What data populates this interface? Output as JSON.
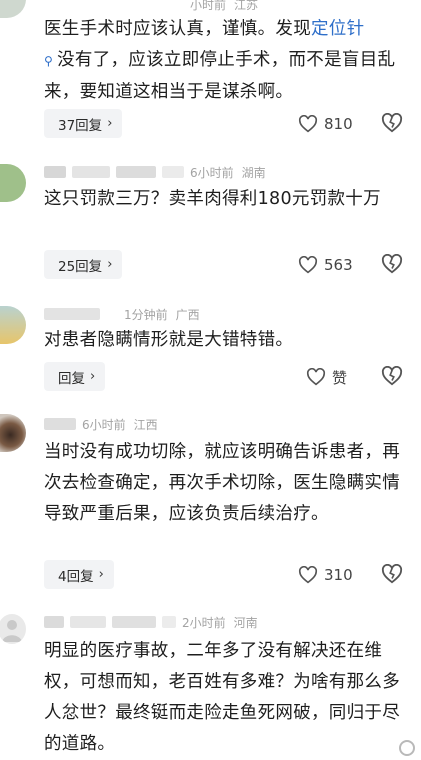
{
  "comments": [
    {
      "meta_time": "小时前",
      "meta_location": "江苏",
      "text_before_link": "医生手术时应该认真，谨慎。发现",
      "link_text": "定位针",
      "text_after_link": "没有了，应该立即停止手术，而不是盲目乱来，要知道这相当于是谋杀啊。",
      "reply_label": "37回复",
      "like_count": "810"
    },
    {
      "meta_time": "6小时前",
      "meta_location": "湖南",
      "text": "这只罚款三万？卖羊肉得利180元罚款十万",
      "reply_label": "25回复",
      "like_count": "563"
    },
    {
      "meta_time": "1分钟前",
      "meta_location": "广西",
      "text": "对患者隐瞒情形就是大错特错。",
      "reply_label": "回复",
      "like_count": "赞"
    },
    {
      "meta_time": "6小时前",
      "meta_location": "江西",
      "text": "当时没有成功切除，就应该明确告诉患者，再次去检查确定，再次手术切除，医生隐瞒实情导致严重后果，应该负责后续治疗。",
      "reply_label": "4回复",
      "like_count": "310"
    },
    {
      "meta_time": "2小时前",
      "meta_location": "河南",
      "text": "明显的医疗事故，二年多了没有解决还在维权，可想而知，老百姓有多难？为啥有那么多人忿世？最终铤而走险走鱼死网破，同归于尽的道路。"
    }
  ],
  "icons": {
    "chevron": "›",
    "like": "heart-outline-icon",
    "dislike": "heart-broken-icon"
  },
  "colors": {
    "link": "#2f6fc9",
    "meta": "#a3a3a3",
    "reply_bg": "#f2f3f5"
  }
}
